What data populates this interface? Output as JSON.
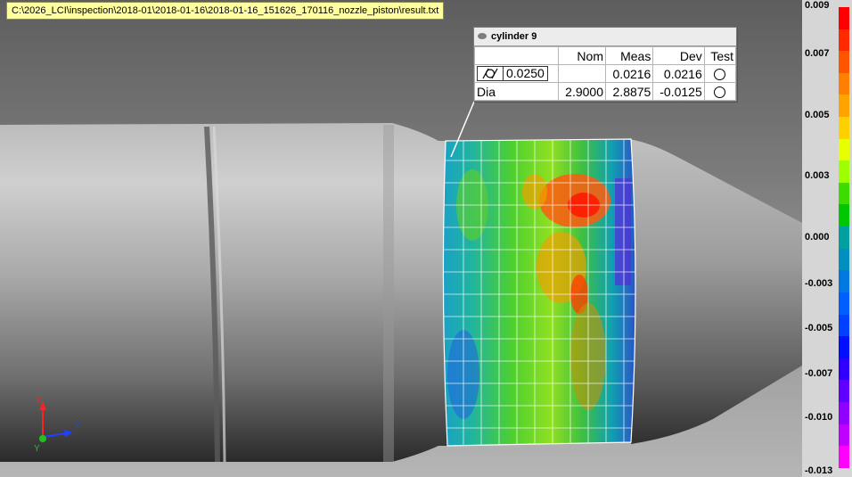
{
  "file_path": "C:\\2026_LCI\\inspection\\2018-01\\2018-01-16\\2018-01-16_151626_170116_nozzle_piston\\result.txt",
  "callout": {
    "title": "cylinder 9",
    "headers": {
      "nom": "Nom",
      "meas": "Meas",
      "dev": "Dev",
      "test": "Test"
    },
    "rows": [
      {
        "label": "",
        "tolerance": "0.0250",
        "nom": "",
        "meas": "0.0216",
        "dev": "0.0216"
      },
      {
        "label": "Dia",
        "tolerance": "",
        "nom": "2.9000",
        "meas": "2.8875",
        "dev": "-0.0125"
      }
    ]
  },
  "colorbar": {
    "labels": [
      "0.009",
      "0.007",
      "0.005",
      "0.003",
      "0.000",
      "-0.003",
      "-0.005",
      "-0.007",
      "-0.010",
      "-0.013"
    ],
    "colors": [
      "#ff0000",
      "#ff2a00",
      "#ff5500",
      "#ff7f00",
      "#ffa300",
      "#ffd000",
      "#e8ff00",
      "#9dff00",
      "#3ddc00",
      "#00c800",
      "#00a0a0",
      "#0090c0",
      "#0078e0",
      "#0060ff",
      "#0040ff",
      "#0010ff",
      "#3000ff",
      "#6000ff",
      "#9000ff",
      "#c000ff",
      "#ff00ff"
    ]
  },
  "axes": {
    "x": "X",
    "y": "Y",
    "z": "Z",
    "x_color": "#ff2020",
    "y_color": "#20c020",
    "z_color": "#2040ff"
  }
}
